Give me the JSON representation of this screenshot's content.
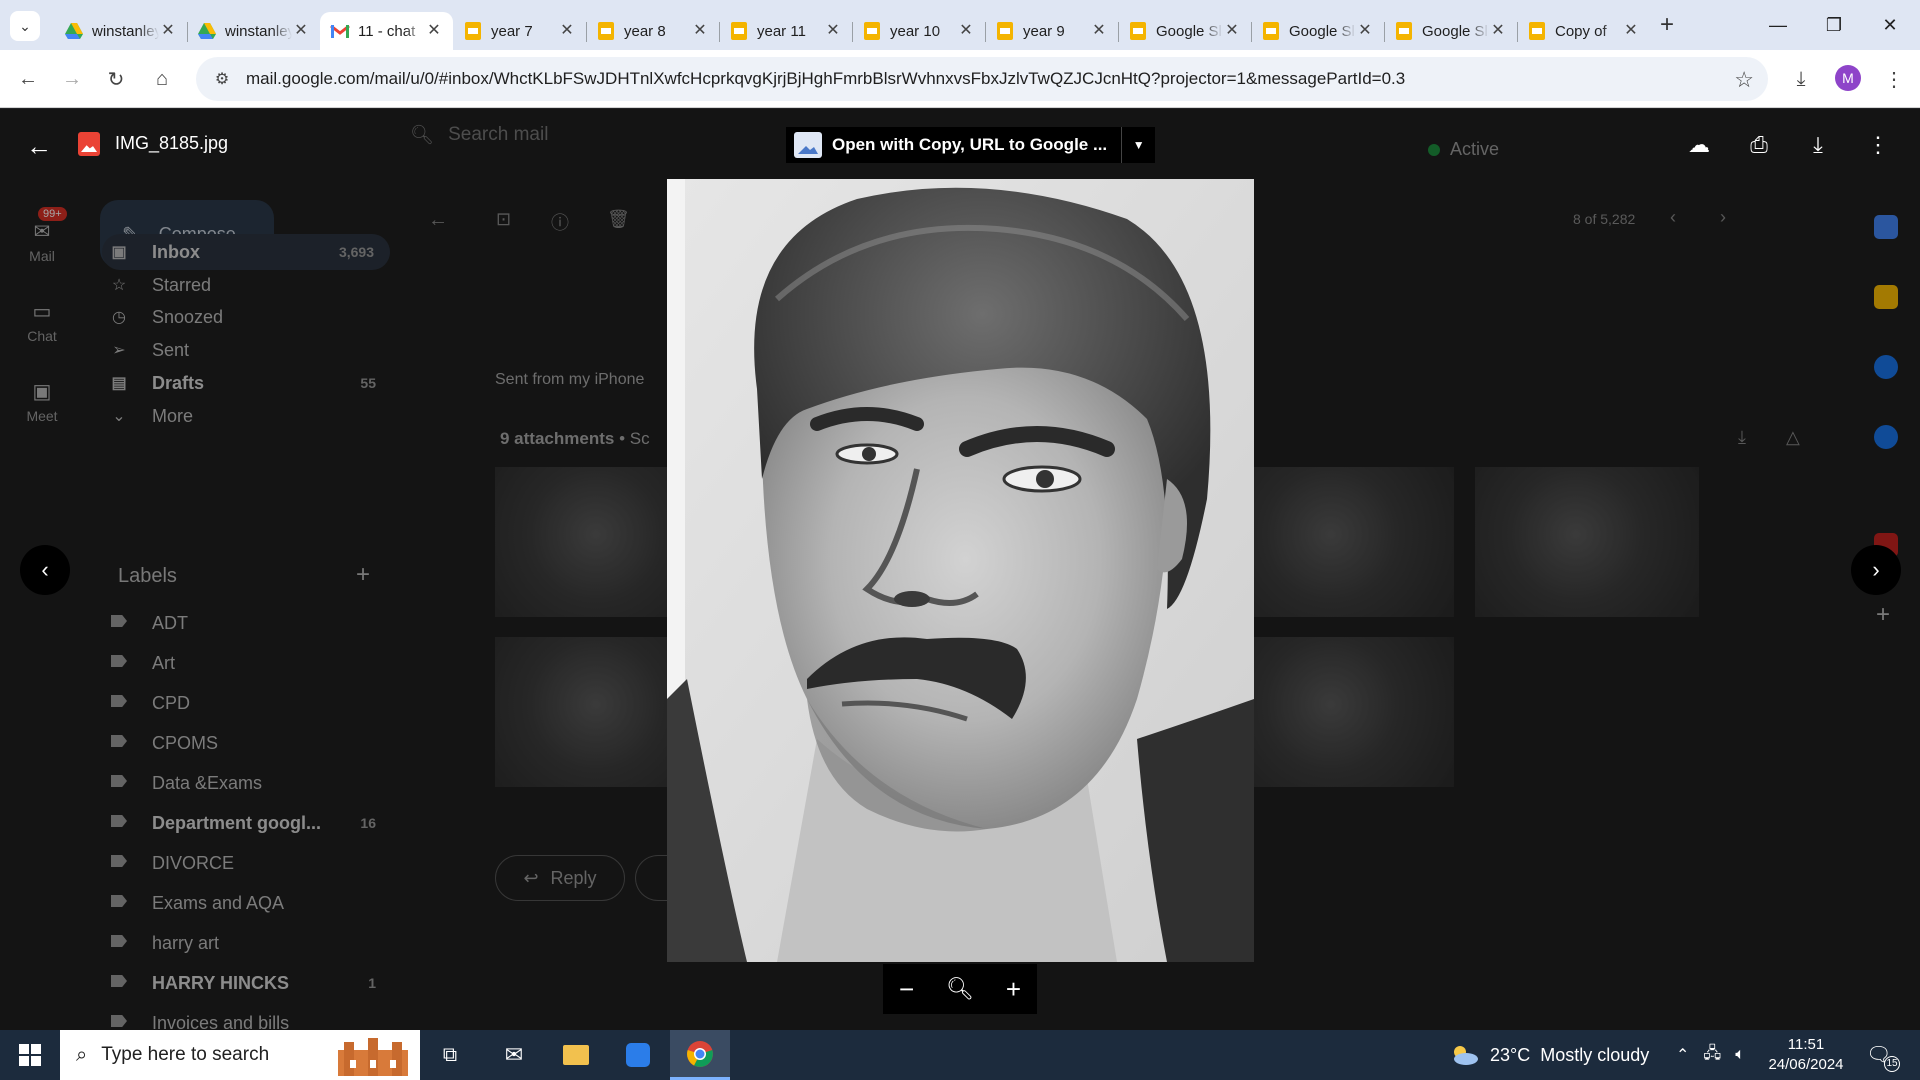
{
  "browser": {
    "tabs": [
      {
        "title": "winstanley college",
        "icon": "google-drive-icon"
      },
      {
        "title": "winstanley college",
        "icon": "google-drive-icon"
      },
      {
        "title": "11 - chat",
        "icon": "gmail-icon",
        "active": true
      },
      {
        "title": "year 7",
        "icon": "google-slides-icon"
      },
      {
        "title": "year 8",
        "icon": "google-slides-icon"
      },
      {
        "title": "year 11",
        "icon": "google-slides-icon"
      },
      {
        "title": "year 10",
        "icon": "google-slides-icon"
      },
      {
        "title": "year 9",
        "icon": "google-slides-icon"
      },
      {
        "title": "Google Slides",
        "icon": "google-slides-icon"
      },
      {
        "title": "Google Slides",
        "icon": "google-slides-icon"
      },
      {
        "title": "Google Slides",
        "icon": "google-slides-icon"
      },
      {
        "title": "Copy of",
        "icon": "google-slides-icon"
      }
    ],
    "url": "mail.google.com/mail/u/0/#inbox/WhctKLbFSwJDHTnlXwfcHcprkqvgKjrjBjHghFmrbBlsrWvhnxvsFbxJzlvTwQZJCJcnHtQ?projector=1&messagePartId=0.3",
    "profile_initial": "M"
  },
  "gmail": {
    "search_placeholder": "Search mail",
    "compose_label": "Compose",
    "status_label": "Active",
    "rail": [
      {
        "label": "Mail",
        "badge": "99+"
      },
      {
        "label": "Chat"
      },
      {
        "label": "Meet"
      }
    ],
    "folders": [
      {
        "label": "Inbox",
        "count": "3,693",
        "bold": true
      },
      {
        "label": "Starred",
        "count": ""
      },
      {
        "label": "Snoozed",
        "count": ""
      },
      {
        "label": "Sent",
        "count": ""
      },
      {
        "label": "Drafts",
        "count": "55",
        "bold": true
      },
      {
        "label": "More",
        "count": ""
      }
    ],
    "labels_heading": "Labels",
    "labels": [
      {
        "label": "ADT",
        "count": ""
      },
      {
        "label": "Art",
        "count": ""
      },
      {
        "label": "CPD",
        "count": ""
      },
      {
        "label": "CPOMS",
        "count": ""
      },
      {
        "label": "Data &Exams",
        "count": ""
      },
      {
        "label": "Department googl...",
        "count": "16",
        "bold": true
      },
      {
        "label": "DIVORCE",
        "count": ""
      },
      {
        "label": "Exams and AQA",
        "count": ""
      },
      {
        "label": "harry art",
        "count": ""
      },
      {
        "label": "HARRY HINCKS",
        "count": "1",
        "bold": true
      },
      {
        "label": "Invoices and bills",
        "count": ""
      }
    ],
    "pager": "8 of 5,282",
    "message_body": "Sent from my iPhone",
    "attachments_heading": "9 attachments",
    "attachments_scanned": "• Sc",
    "reply_label": "Reply"
  },
  "viewer": {
    "file_name": "IMG_8185.jpg",
    "open_with_label": "Open with Copy, URL to Google ..."
  },
  "taskbar": {
    "search_placeholder": "Type here to search",
    "weather": "23°C  Mostly cloudy",
    "time": "11:51",
    "date": "24/06/2024",
    "notifications": "15"
  }
}
